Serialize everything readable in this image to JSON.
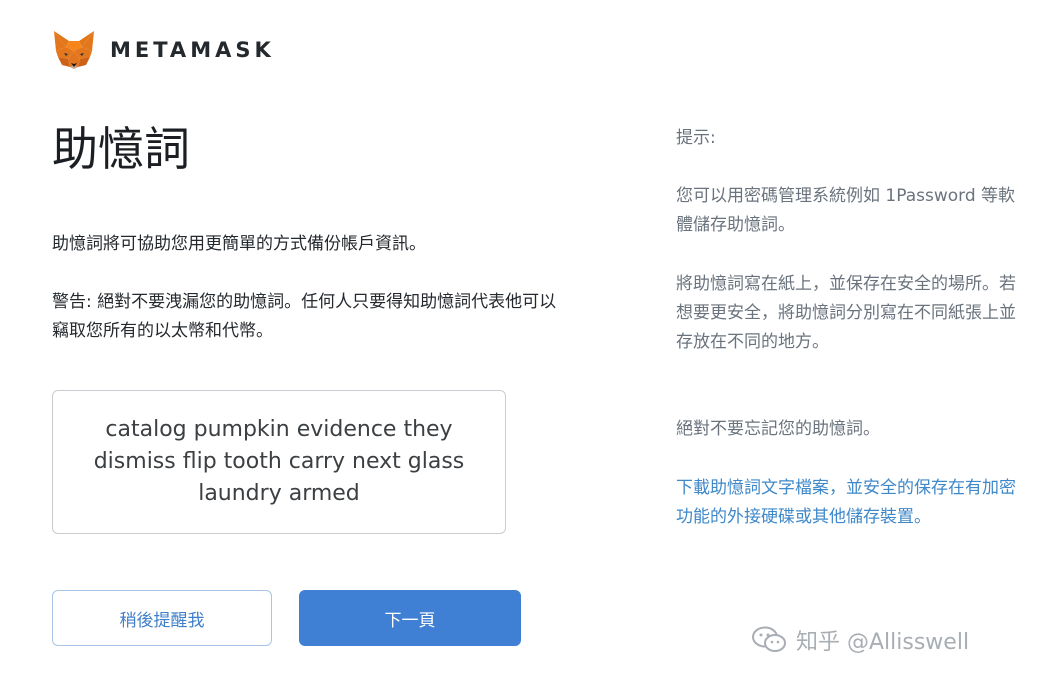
{
  "header": {
    "brand": "METAMASK",
    "logo_icon": "metamask-fox-icon"
  },
  "main": {
    "title": "助憶詞",
    "description": "助憶詞將可協助您用更簡單的方式備份帳戶資訊。",
    "warning": "警告: 絕對不要洩漏您的助憶詞。任何人只要得知助憶詞代表他可以竊取您所有的以太幣和代幣。",
    "seed_phrase": "catalog pumpkin evidence they dismiss flip tooth carry next glass laundry armed",
    "remind_label": "稍後提醒我",
    "next_label": "下一頁"
  },
  "tips": {
    "heading": "提示:",
    "tip1": "您可以用密碼管理系統例如 1Password 等軟體儲存助憶詞。",
    "tip2": "將助憶詞寫在紙上，並保存在安全的場所。若想要更安全，將助憶詞分別寫在不同紙張上並存放在不同的地方。",
    "tip3": "絕對不要忘記您的助憶詞。",
    "download_link": "下載助憶詞文字檔案，並安全的保存在有加密功能的外接硬碟或其他儲存裝置。"
  },
  "watermark": {
    "text": "知乎 @Allisswell",
    "icon": "wechat-icon"
  },
  "colors": {
    "accent": "#3f7fd4",
    "link": "#3f88c9",
    "muted": "#6a737d",
    "text": "#24292e"
  }
}
